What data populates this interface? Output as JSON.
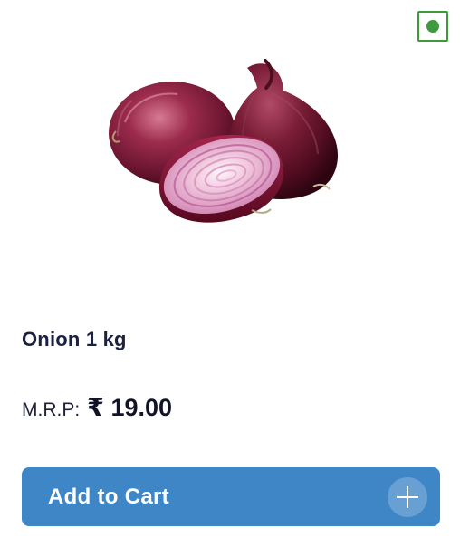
{
  "product": {
    "name": "Onion 1 kg",
    "mrp_label": "M.R.P:",
    "price": "₹ 19.00",
    "image_icon": "onion-image",
    "veg_indicator": "veg-indicator-icon"
  },
  "actions": {
    "add_to_cart_label": "Add to Cart",
    "add_icon": "plus-icon"
  },
  "colors": {
    "accent": "#3f86c7",
    "veg": "#3f9a3d",
    "text": "#1b2140"
  }
}
